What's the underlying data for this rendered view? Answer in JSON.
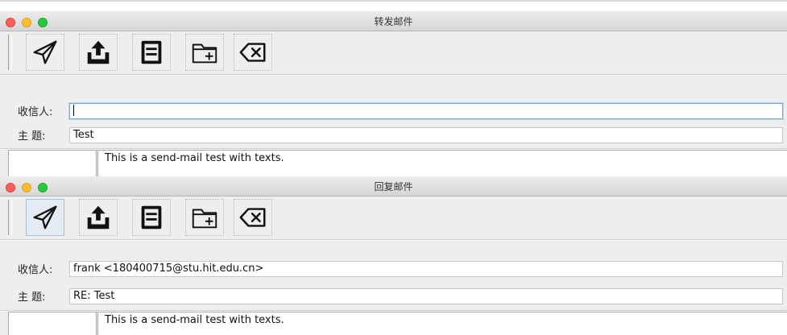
{
  "windows": [
    {
      "title": "转发邮件",
      "recipient_label": "收信人:",
      "recipient_value": "",
      "subject_label": "主 题:",
      "subject_value": "Test",
      "body_text": "This is a send-mail test with texts."
    },
    {
      "title": "回复邮件",
      "recipient_label": "收信人:",
      "recipient_value": "frank <180400715@stu.hit.edu.cn>",
      "subject_label": "主 题:",
      "subject_value": "RE: Test",
      "body_text": "This is a send-mail test with texts."
    }
  ],
  "toolbar_icons": [
    "send-icon",
    "upload-attachment-icon",
    "save-draft-icon",
    "add-folder-icon",
    "delete-icon"
  ],
  "colors": {
    "close": "#fe5f57",
    "minimize": "#febc2e",
    "zoom": "#28c840",
    "focus_ring": "#7aa7d6"
  }
}
